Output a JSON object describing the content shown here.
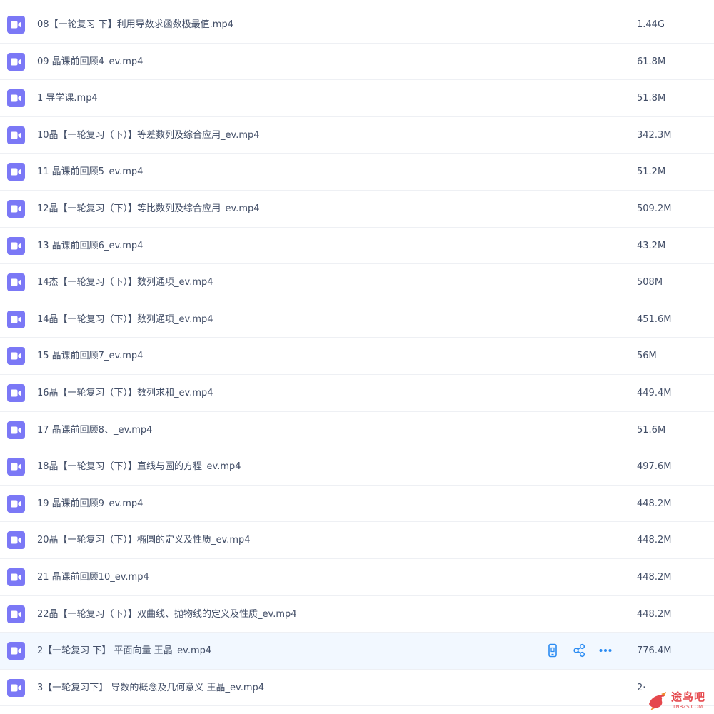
{
  "files": [
    {
      "name": "08【一轮复习 下】利用导数求函数极最值.mp4",
      "size": "1.44G"
    },
    {
      "name": "09 晶课前回顾4_ev.mp4",
      "size": "61.8M"
    },
    {
      "name": "1 导学课.mp4",
      "size": "51.8M"
    },
    {
      "name": "10晶【一轮复习（下）】等差数列及综合应用_ev.mp4",
      "size": "342.3M"
    },
    {
      "name": "11 晶课前回顾5_ev.mp4",
      "size": "51.2M"
    },
    {
      "name": "12晶【一轮复习（下）】等比数列及综合应用_ev.mp4",
      "size": "509.2M"
    },
    {
      "name": "13 晶课前回顾6_ev.mp4",
      "size": "43.2M"
    },
    {
      "name": "14杰【一轮复习（下）】数列通项_ev.mp4",
      "size": "508M"
    },
    {
      "name": "14晶【一轮复习（下）】数列通项_ev.mp4",
      "size": "451.6M"
    },
    {
      "name": "15 晶课前回顾7_ev.mp4",
      "size": "56M"
    },
    {
      "name": "16晶【一轮复习（下）】数列求和_ev.mp4",
      "size": "449.4M"
    },
    {
      "name": "17 晶课前回顾8、_ev.mp4",
      "size": "51.6M"
    },
    {
      "name": "18晶【一轮复习（下）】直线与圆的方程_ev.mp4",
      "size": "497.6M"
    },
    {
      "name": "19 晶课前回顾9_ev.mp4",
      "size": "448.2M"
    },
    {
      "name": "20晶【一轮复习（下）】椭圆的定义及性质_ev.mp4",
      "size": "448.2M"
    },
    {
      "name": "21 晶课前回顾10_ev.mp4",
      "size": "448.2M"
    },
    {
      "name": "22晶【一轮复习（下）】双曲线、抛物线的定义及性质_ev.mp4",
      "size": "448.2M"
    },
    {
      "name": "2【一轮复习 下】 平面向量 王晶_ev.mp4",
      "size": "776.4M"
    },
    {
      "name": "3【一轮复习下】 导数的概念及几何意义 王晶_ev.mp4",
      "size": "2·"
    }
  ],
  "hovered_row_index": 17,
  "row_actions": [
    "phone-icon",
    "share-icon",
    "more-icon"
  ],
  "file_icon": "video-file-icon",
  "watermark": {
    "text": "途鸟吧",
    "subtext": "TNBZS.COM"
  },
  "colors": {
    "icon": "#7b78f6",
    "action": "#2a8bf2",
    "text": "#424e67",
    "hover_bg": "#f2f8ff",
    "divider": "#eef0f4",
    "watermark": "#e5484d"
  }
}
